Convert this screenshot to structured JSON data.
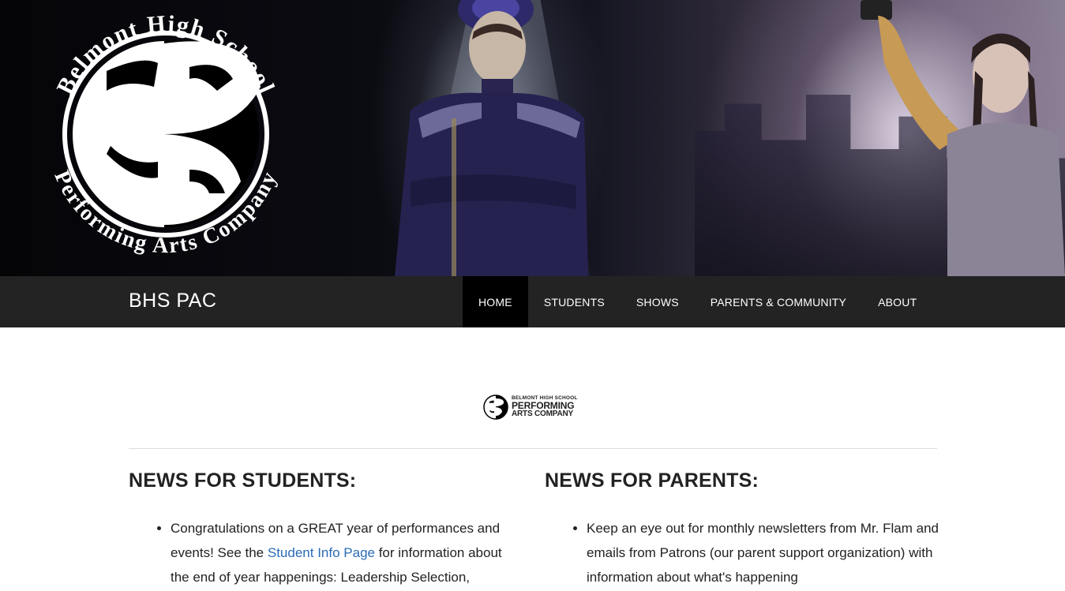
{
  "hero": {
    "logo_text_top": "Belmont High School",
    "logo_text_bottom": "Performing Arts Company"
  },
  "navbar": {
    "brand": "BHS PAC",
    "items": [
      {
        "label": "Home",
        "active": true
      },
      {
        "label": "Students",
        "active": false
      },
      {
        "label": "Shows",
        "active": false
      },
      {
        "label": "Parents & Community",
        "active": false
      },
      {
        "label": "About",
        "active": false
      }
    ]
  },
  "small_logo": {
    "line1": "BELMONT HIGH SCHOOL",
    "line2": "PERFORMING",
    "line3": "ARTS COMPANY"
  },
  "students": {
    "heading": "NEWS FOR STUDENTS:",
    "item1_before": "Congratulations on a GREAT year of performances and events! See the ",
    "item1_link": "Student Info Page",
    "item1_after": " for information about the end of year happenings: Leadership Selection,"
  },
  "parents": {
    "heading": "NEWS FOR PARENTS:",
    "item1": "Keep an eye out for monthly newsletters from Mr. Flam and emails from Patrons (our parent support organization) with information about what's happening"
  },
  "colors": {
    "navbar_bg": "#232323",
    "nav_active_bg": "#000000",
    "link": "#2a6bb5"
  }
}
